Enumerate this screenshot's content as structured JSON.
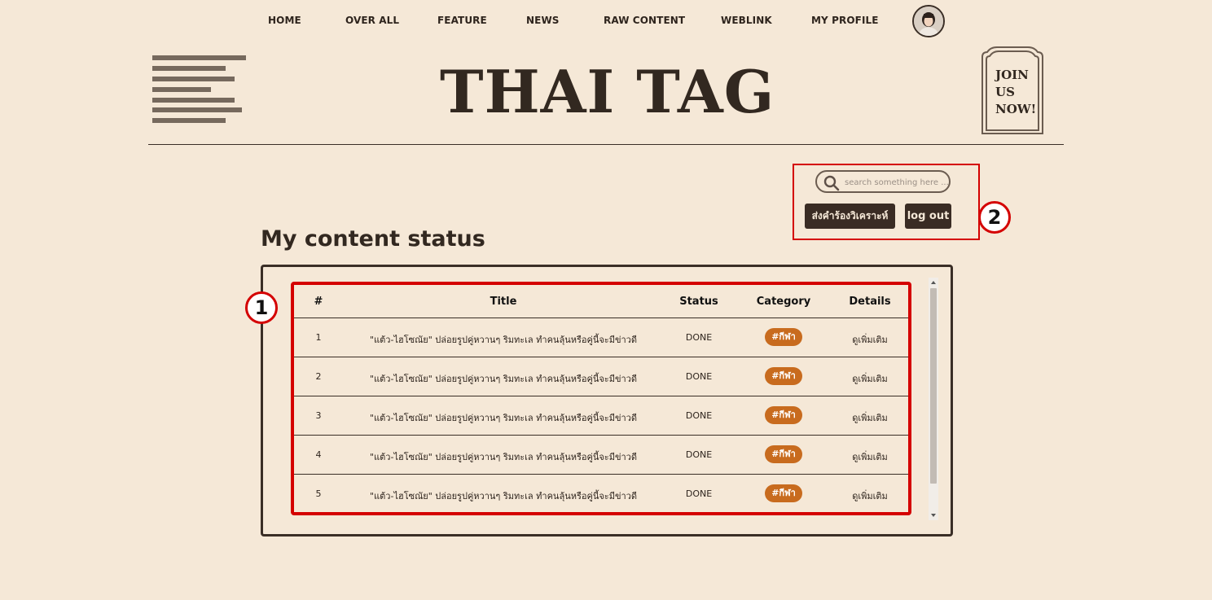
{
  "nav": {
    "items": [
      "HOME",
      "OVER ALL",
      "FEATURE",
      "NEWS",
      "RAW CONTENT",
      "WEBLINK",
      "MY PROFILE"
    ]
  },
  "header": {
    "logo": "THAI TAG",
    "join_line1": "JOIN",
    "join_line2": "US",
    "join_line3": "NOW!"
  },
  "tools": {
    "search_placeholder": "search something here ...",
    "request_button": "ส่งคำร้องวิเคราะห์",
    "logout_button": "log out"
  },
  "annotations": {
    "marker1": "1",
    "marker2": "2"
  },
  "main": {
    "title": "My content status",
    "columns": [
      "#",
      "Title",
      "Status",
      "Category",
      "Details"
    ],
    "rows": [
      {
        "num": "1",
        "title": "\"แต้ว-ไฮโซณัย\" ปล่อยรูปคู่หวานๆ ริมทะเล ทำคนลุ้นหรือคู่นี้จะมีข่าวดี",
        "status": "DONE",
        "category": "#กีฬา",
        "details": "ดูเพิ่มเติม"
      },
      {
        "num": "2",
        "title": "\"แต้ว-ไฮโซณัย\" ปล่อยรูปคู่หวานๆ ริมทะเล ทำคนลุ้นหรือคู่นี้จะมีข่าวดี",
        "status": "DONE",
        "category": "#กีฬา",
        "details": "ดูเพิ่มเติม"
      },
      {
        "num": "3",
        "title": "\"แต้ว-ไฮโซณัย\" ปล่อยรูปคู่หวานๆ ริมทะเล ทำคนลุ้นหรือคู่นี้จะมีข่าวดี",
        "status": "DONE",
        "category": "#กีฬา",
        "details": "ดูเพิ่มเติม"
      },
      {
        "num": "4",
        "title": "\"แต้ว-ไฮโซณัย\" ปล่อยรูปคู่หวานๆ ริมทะเล ทำคนลุ้นหรือคู่นี้จะมีข่าวดี",
        "status": "DONE",
        "category": "#กีฬา",
        "details": "ดูเพิ่มเติม"
      },
      {
        "num": "5",
        "title": "\"แต้ว-ไฮโซณัย\" ปล่อยรูปคู่หวานๆ ริมทะเล ทำคนลุ้นหรือคู่นี้จะมีข่าวดี",
        "status": "DONE",
        "category": "#กีฬา",
        "details": "ดูเพิ่มเติม"
      }
    ]
  },
  "colors": {
    "background": "#f5e8d7",
    "dark": "#3a2c24",
    "tag": "#c86b1e",
    "highlight": "#d40000"
  }
}
